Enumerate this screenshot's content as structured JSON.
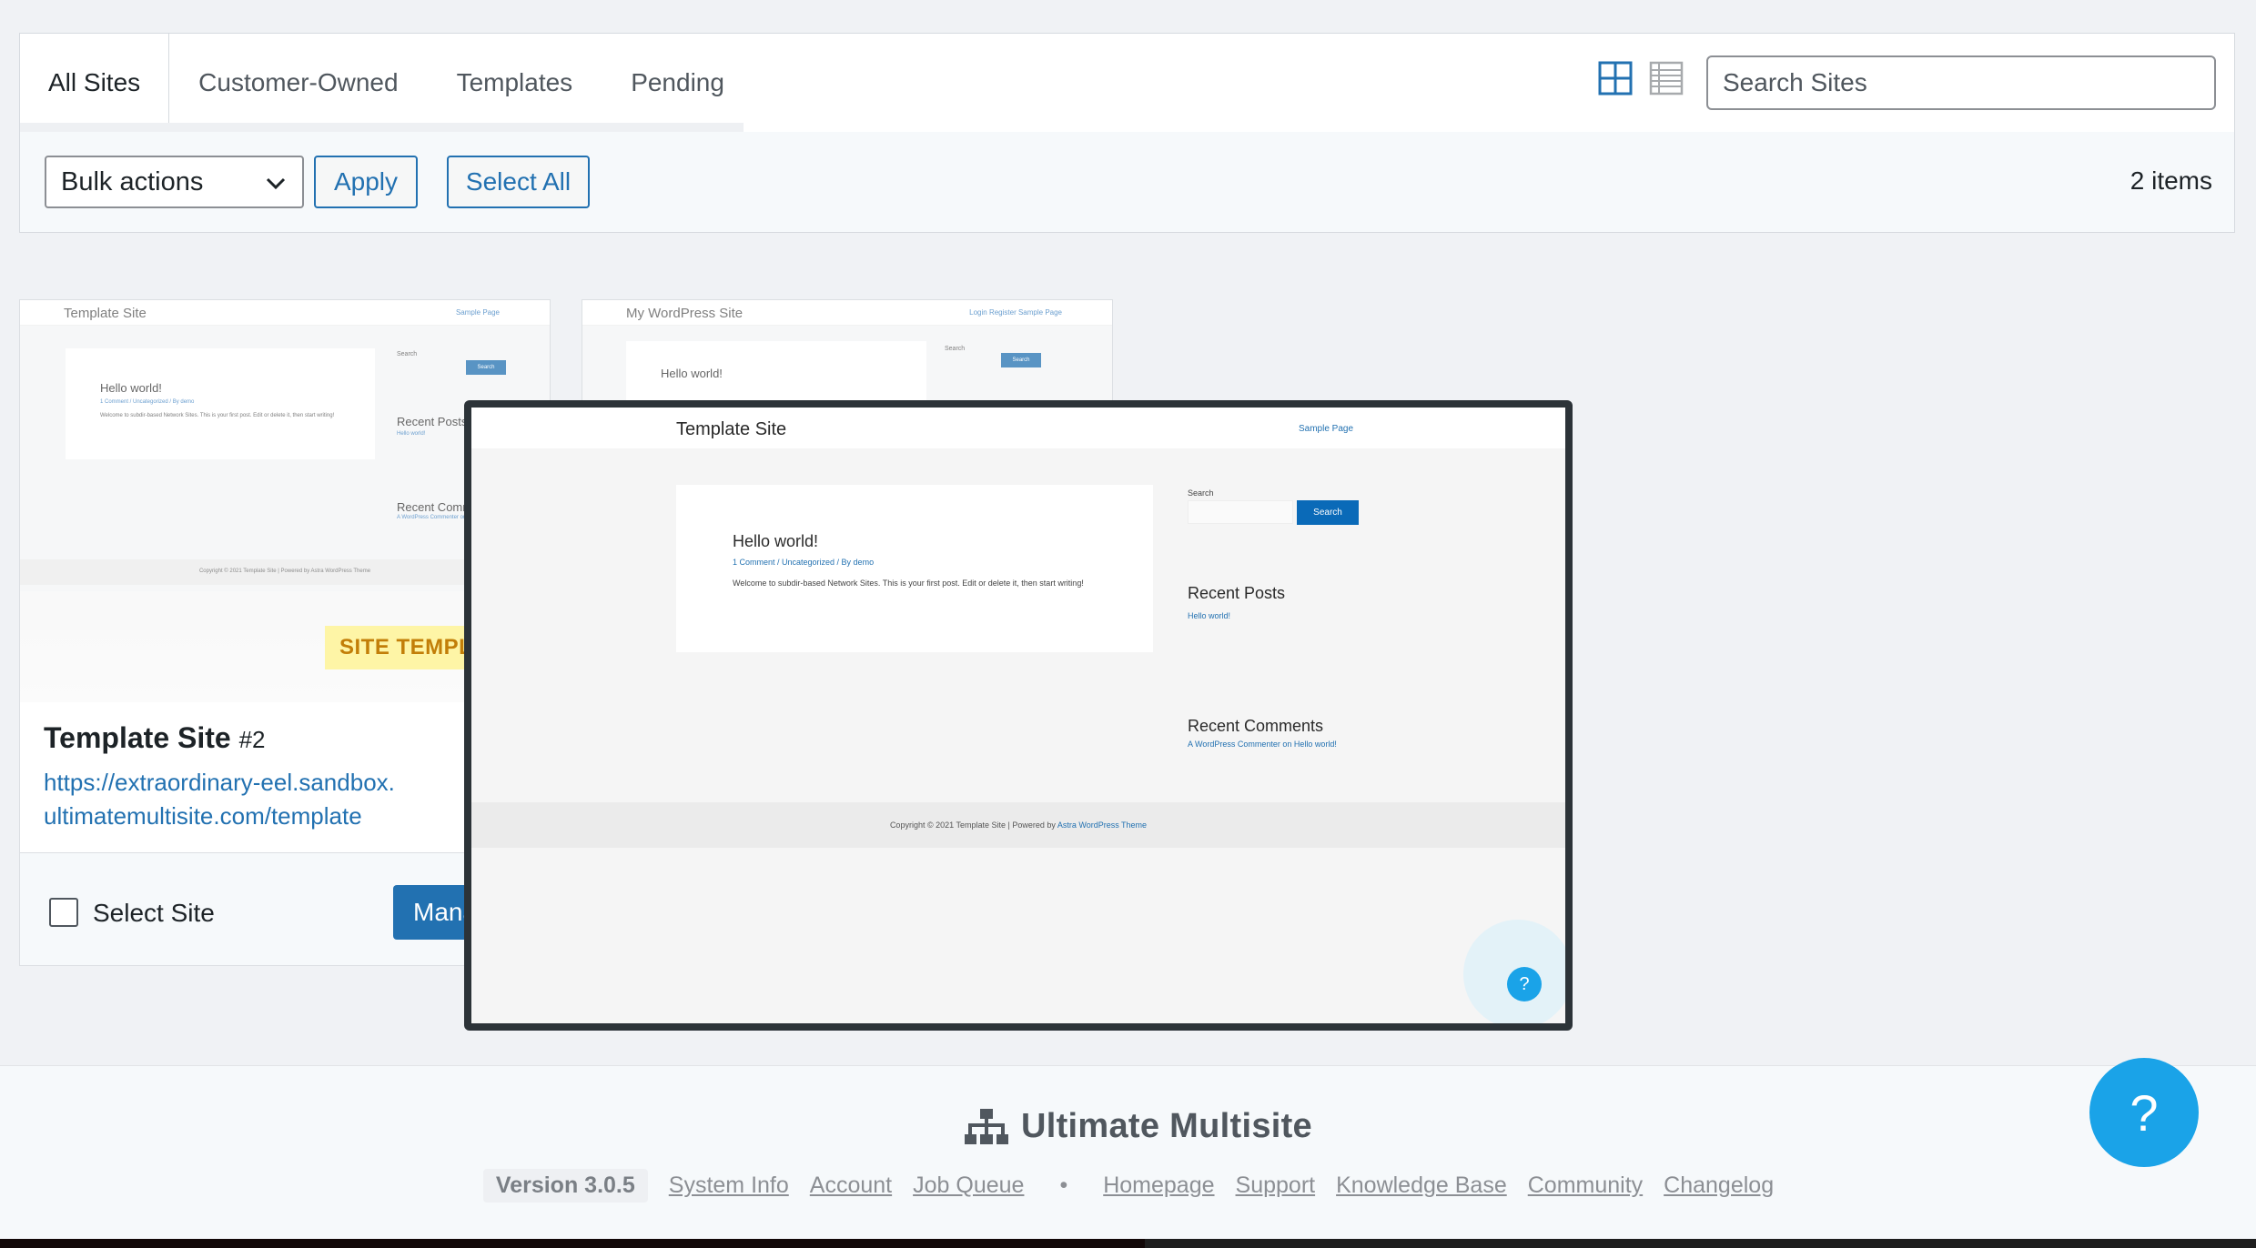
{
  "tabs": [
    {
      "label": "All Sites",
      "active": true
    },
    {
      "label": "Customer-Owned",
      "active": false
    },
    {
      "label": "Templates",
      "active": false
    },
    {
      "label": "Pending",
      "active": false
    }
  ],
  "view_toggle": {
    "grid_icon": "grid-view-icon",
    "list_icon": "list-view-icon",
    "active": "grid"
  },
  "search": {
    "placeholder": "Search Sites",
    "value": ""
  },
  "bulk": {
    "select_value": "Bulk actions",
    "apply_label": "Apply",
    "select_all_label": "Select All",
    "items_count": "2 items"
  },
  "cards": [
    {
      "thumb": {
        "site_title": "Template Site",
        "nav": "Sample Page",
        "post_title": "Hello world!",
        "post_meta": "1 Comment / Uncategorized / By demo",
        "post_text": "Welcome to subdir-based Network Sites. This is your first post. Edit or delete it, then start writing!",
        "search_label": "Search",
        "search_btn": "Search",
        "recent_posts": "Recent Posts",
        "recent_posts_link": "Hello world!",
        "recent_comments": "Recent Comm",
        "recent_comments_link": "A WordPress Commenter on",
        "footer": "Copyright © 2021 Template Site | Powered by Astra WordPress Theme"
      },
      "badge": "SITE TEMPL",
      "title": "Template Site",
      "id": "#2",
      "url_line1": "https://extraordinary-eel.sandbox.",
      "url_line2": "ultimatemultisite.com/template",
      "select_label": "Select Site",
      "manage_label": "Mana"
    },
    {
      "thumb": {
        "site_title": "My WordPress Site",
        "nav": "Login   Register   Sample Page",
        "post_title": "Hello world!",
        "search_label": "Search",
        "search_btn": "Search"
      }
    }
  ],
  "preview": {
    "site_title": "Template Site",
    "nav": "Sample Page",
    "post_title": "Hello world!",
    "post_meta": "1 Comment / Uncategorized / By demo",
    "post_text": "Welcome to subdir-based Network Sites. This is your first post. Edit or delete it, then start writing!",
    "search_label": "Search",
    "search_btn": "Search",
    "recent_posts": "Recent Posts",
    "recent_posts_link": "Hello world!",
    "recent_comments": "Recent Comments",
    "recent_comments_link": "A WordPress Commenter on Hello world!",
    "footer_text": "Copyright © 2021 Template Site | Powered by",
    "footer_link": "Astra WordPress Theme",
    "help": "?"
  },
  "footer": {
    "brand": "Ultimate Multisite",
    "version": "Version 3.0.5",
    "links_left": [
      "System Info",
      "Account",
      "Job Queue"
    ],
    "separator": "•",
    "links_right": [
      "Homepage",
      "Support",
      "Knowledge Base",
      "Community",
      "Changelog"
    ]
  },
  "help_button": "?",
  "colors": {
    "accent": "#2271b1",
    "help": "#1aa3e8",
    "badge_bg": "#fef5a6",
    "badge_text": "#c27e08"
  }
}
